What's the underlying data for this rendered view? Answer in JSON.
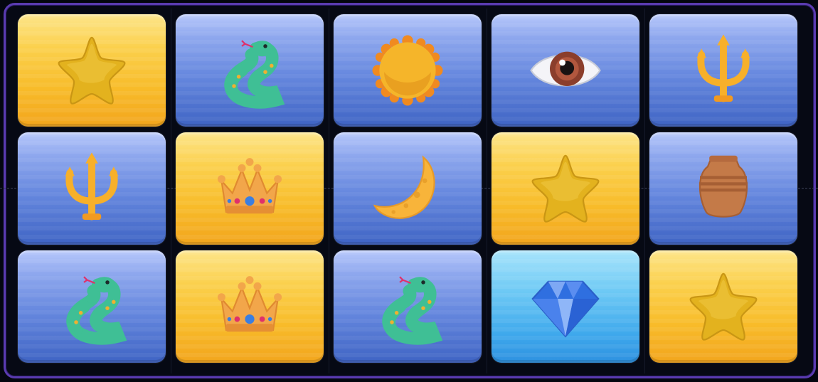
{
  "board": {
    "rows": [
      [
        {
          "symbol": "star-icon",
          "bg": "gold"
        },
        {
          "symbol": "snake-icon",
          "bg": "blue"
        },
        {
          "symbol": "sun-icon",
          "bg": "blue"
        },
        {
          "symbol": "eye-icon",
          "bg": "blue"
        },
        {
          "symbol": "trident-icon",
          "bg": "blue"
        }
      ],
      [
        {
          "symbol": "trident-icon",
          "bg": "blue"
        },
        {
          "symbol": "crown-icon",
          "bg": "gold"
        },
        {
          "symbol": "moon-icon",
          "bg": "blue"
        },
        {
          "symbol": "star-icon",
          "bg": "gold"
        },
        {
          "symbol": "urn-icon",
          "bg": "blue"
        }
      ],
      [
        {
          "symbol": "snake-icon",
          "bg": "blue"
        },
        {
          "symbol": "crown-icon",
          "bg": "gold"
        },
        {
          "symbol": "snake-icon",
          "bg": "blue"
        },
        {
          "symbol": "diamond-icon",
          "bg": "cyan"
        },
        {
          "symbol": "star-icon",
          "bg": "gold"
        }
      ]
    ]
  },
  "colors": {
    "frame_border": "#5a3bb0",
    "background": "#04070f",
    "tile_blue": "#6587de",
    "tile_gold": "#f8bc2a",
    "tile_cyan": "#3ea8ec"
  }
}
